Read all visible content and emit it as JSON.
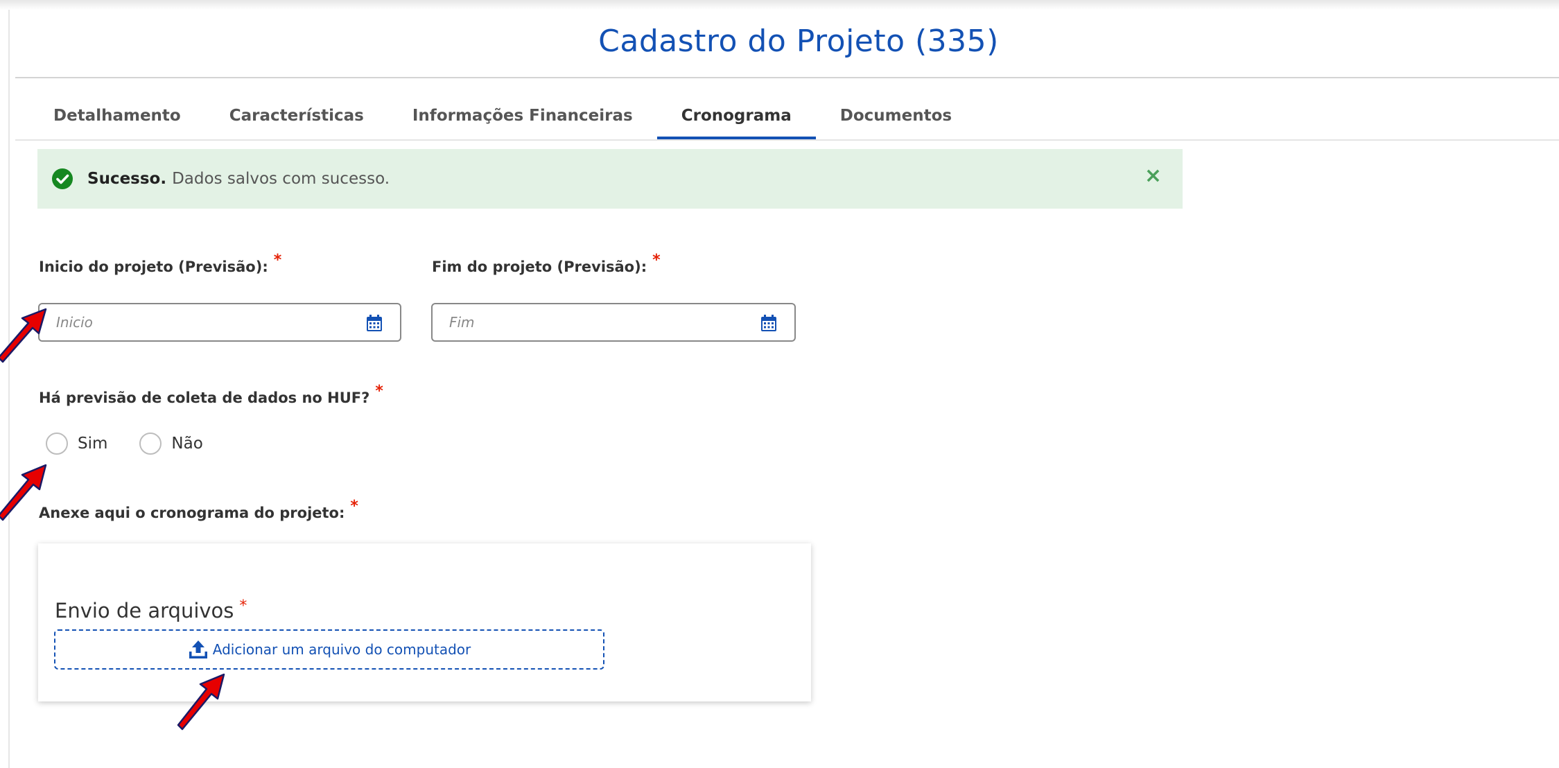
{
  "header": {
    "title": "Cadastro do Projeto (335)"
  },
  "tabs": [
    {
      "label": "Detalhamento",
      "active": false
    },
    {
      "label": "Características",
      "active": false
    },
    {
      "label": "Informações Financeiras",
      "active": false
    },
    {
      "label": "Cronograma",
      "active": true
    },
    {
      "label": "Documentos",
      "active": false
    }
  ],
  "alert": {
    "title": "Sucesso.",
    "message": "Dados salvos com sucesso.",
    "close_symbol": "×",
    "icon": "check-circle-icon",
    "color": "#e3f2e5"
  },
  "form": {
    "required_marker": "*",
    "start_date": {
      "label": "Inicio do projeto (Previsão):",
      "placeholder": "Inicio",
      "value": ""
    },
    "end_date": {
      "label": "Fim do projeto (Previsão):",
      "placeholder": "Fim",
      "value": ""
    },
    "data_collection": {
      "label": "Há previsão de coleta de dados no HUF?",
      "options": [
        "Sim",
        "Não"
      ],
      "selected": null
    },
    "schedule_attachment": {
      "label": "Anexe aqui o cronograma do projeto:"
    }
  },
  "upload": {
    "title": "Envio de arquivos",
    "button_label": "Adicionar um arquivo do computador",
    "icon": "upload-icon"
  },
  "theme": {
    "primary": "#1351b4",
    "required": "#e52207",
    "success_icon": "#168821",
    "annotation_arrow": "#e60000"
  }
}
